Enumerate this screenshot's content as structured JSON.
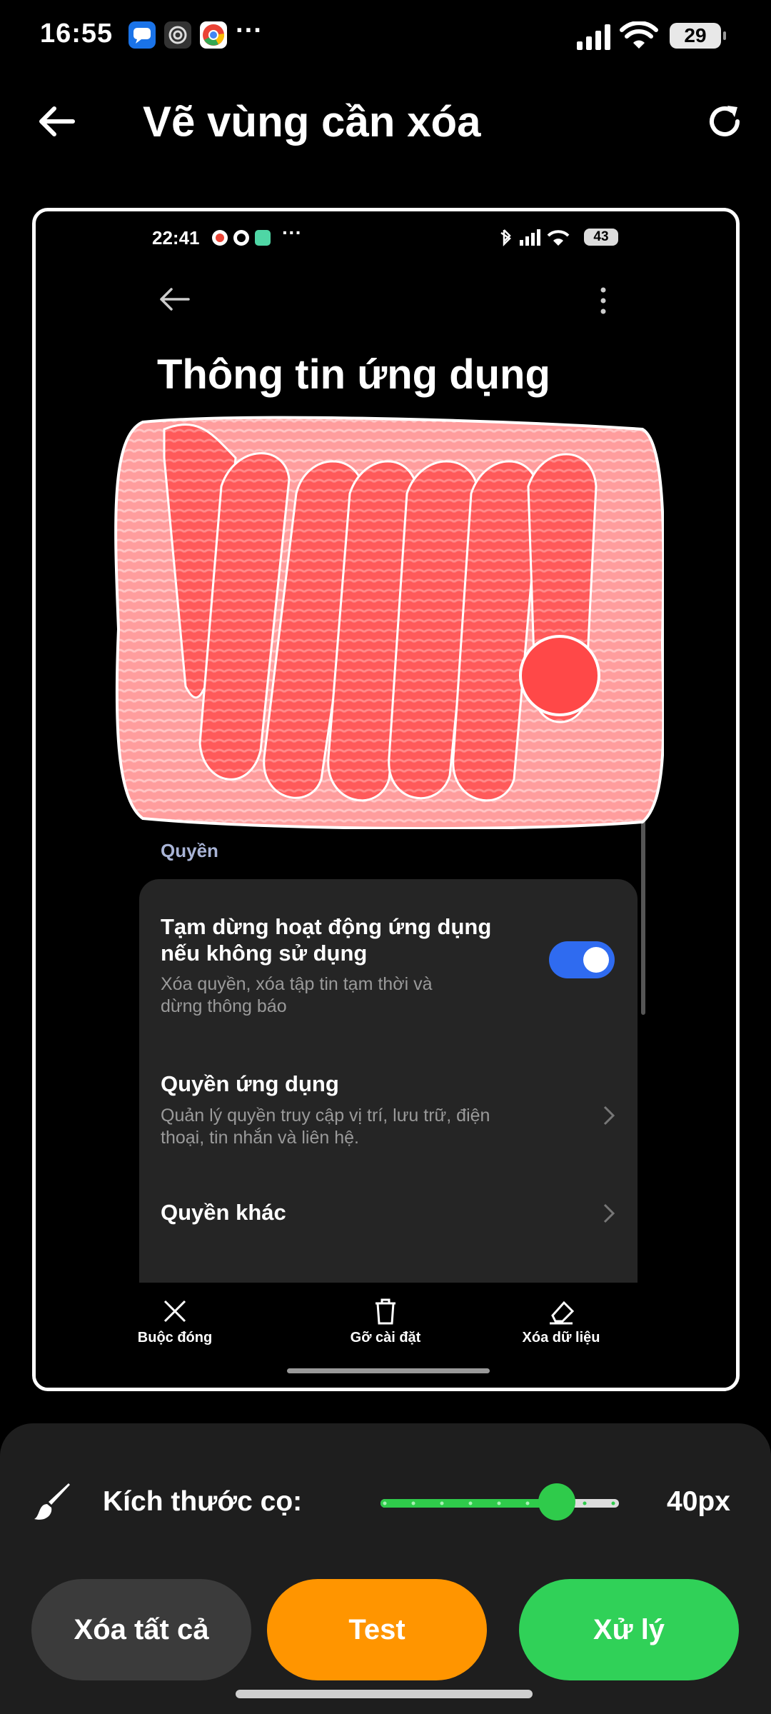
{
  "status_bar": {
    "time": "16:55",
    "battery": "29",
    "app_icons": [
      "messages-icon",
      "threads-icon",
      "chrome-icon"
    ],
    "overflow": "···"
  },
  "header": {
    "title": "Vẽ vùng cần xóa",
    "back_icon": "arrow-left-icon",
    "refresh_icon": "refresh-icon"
  },
  "preview": {
    "status_time": "22:41",
    "status_battery": "43",
    "status_overflow": "···",
    "title": "Thông tin ứng dụng",
    "section_header": "Quyền",
    "items": [
      {
        "title_line1": "Tạm dừng hoạt động ứng dụng",
        "title_line2": "nếu không sử dụng",
        "subtitle_line1": "Xóa quyền, xóa tập tin tạm thời và",
        "subtitle_line2": "dừng thông báo",
        "toggle_on": true
      },
      {
        "title": "Quyền ứng dụng",
        "subtitle_line1": "Quản lý quyền truy cập vị trí, lưu trữ, điện",
        "subtitle_line2": "thoại, tin nhắn và liên hệ."
      },
      {
        "title": "Quyền khác"
      }
    ],
    "bottom_actions": [
      {
        "label": "Buộc đóng",
        "icon": "close-icon"
      },
      {
        "label": "Gỡ cài đặt",
        "icon": "trash-icon"
      },
      {
        "label": "Xóa dữ liệu",
        "icon": "eraser-icon"
      }
    ],
    "paint_color": "#ff4d4d"
  },
  "panel": {
    "brush_label": "Kích thước cọ:",
    "brush_size": "40px",
    "slider_fraction": 0.74,
    "buttons": {
      "clear_all": "Xóa tất cả",
      "test": "Test",
      "process": "Xử lý"
    },
    "colors": {
      "accent_green": "#30d158",
      "accent_orange": "#ff9500",
      "neutral": "#3b3b3b"
    }
  }
}
